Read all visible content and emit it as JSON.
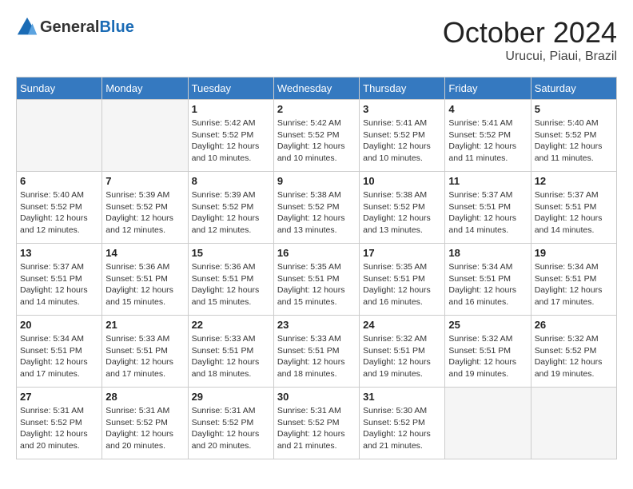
{
  "header": {
    "logo_general": "General",
    "logo_blue": "Blue",
    "month": "October 2024",
    "location": "Urucui, Piaui, Brazil"
  },
  "days_of_week": [
    "Sunday",
    "Monday",
    "Tuesday",
    "Wednesday",
    "Thursday",
    "Friday",
    "Saturday"
  ],
  "weeks": [
    [
      {
        "day": "",
        "info": ""
      },
      {
        "day": "",
        "info": ""
      },
      {
        "day": "1",
        "info": "Sunrise: 5:42 AM\nSunset: 5:52 PM\nDaylight: 12 hours and 10 minutes."
      },
      {
        "day": "2",
        "info": "Sunrise: 5:42 AM\nSunset: 5:52 PM\nDaylight: 12 hours and 10 minutes."
      },
      {
        "day": "3",
        "info": "Sunrise: 5:41 AM\nSunset: 5:52 PM\nDaylight: 12 hours and 10 minutes."
      },
      {
        "day": "4",
        "info": "Sunrise: 5:41 AM\nSunset: 5:52 PM\nDaylight: 12 hours and 11 minutes."
      },
      {
        "day": "5",
        "info": "Sunrise: 5:40 AM\nSunset: 5:52 PM\nDaylight: 12 hours and 11 minutes."
      }
    ],
    [
      {
        "day": "6",
        "info": "Sunrise: 5:40 AM\nSunset: 5:52 PM\nDaylight: 12 hours and 12 minutes."
      },
      {
        "day": "7",
        "info": "Sunrise: 5:39 AM\nSunset: 5:52 PM\nDaylight: 12 hours and 12 minutes."
      },
      {
        "day": "8",
        "info": "Sunrise: 5:39 AM\nSunset: 5:52 PM\nDaylight: 12 hours and 12 minutes."
      },
      {
        "day": "9",
        "info": "Sunrise: 5:38 AM\nSunset: 5:52 PM\nDaylight: 12 hours and 13 minutes."
      },
      {
        "day": "10",
        "info": "Sunrise: 5:38 AM\nSunset: 5:52 PM\nDaylight: 12 hours and 13 minutes."
      },
      {
        "day": "11",
        "info": "Sunrise: 5:37 AM\nSunset: 5:51 PM\nDaylight: 12 hours and 14 minutes."
      },
      {
        "day": "12",
        "info": "Sunrise: 5:37 AM\nSunset: 5:51 PM\nDaylight: 12 hours and 14 minutes."
      }
    ],
    [
      {
        "day": "13",
        "info": "Sunrise: 5:37 AM\nSunset: 5:51 PM\nDaylight: 12 hours and 14 minutes."
      },
      {
        "day": "14",
        "info": "Sunrise: 5:36 AM\nSunset: 5:51 PM\nDaylight: 12 hours and 15 minutes."
      },
      {
        "day": "15",
        "info": "Sunrise: 5:36 AM\nSunset: 5:51 PM\nDaylight: 12 hours and 15 minutes."
      },
      {
        "day": "16",
        "info": "Sunrise: 5:35 AM\nSunset: 5:51 PM\nDaylight: 12 hours and 15 minutes."
      },
      {
        "day": "17",
        "info": "Sunrise: 5:35 AM\nSunset: 5:51 PM\nDaylight: 12 hours and 16 minutes."
      },
      {
        "day": "18",
        "info": "Sunrise: 5:34 AM\nSunset: 5:51 PM\nDaylight: 12 hours and 16 minutes."
      },
      {
        "day": "19",
        "info": "Sunrise: 5:34 AM\nSunset: 5:51 PM\nDaylight: 12 hours and 17 minutes."
      }
    ],
    [
      {
        "day": "20",
        "info": "Sunrise: 5:34 AM\nSunset: 5:51 PM\nDaylight: 12 hours and 17 minutes."
      },
      {
        "day": "21",
        "info": "Sunrise: 5:33 AM\nSunset: 5:51 PM\nDaylight: 12 hours and 17 minutes."
      },
      {
        "day": "22",
        "info": "Sunrise: 5:33 AM\nSunset: 5:51 PM\nDaylight: 12 hours and 18 minutes."
      },
      {
        "day": "23",
        "info": "Sunrise: 5:33 AM\nSunset: 5:51 PM\nDaylight: 12 hours and 18 minutes."
      },
      {
        "day": "24",
        "info": "Sunrise: 5:32 AM\nSunset: 5:51 PM\nDaylight: 12 hours and 19 minutes."
      },
      {
        "day": "25",
        "info": "Sunrise: 5:32 AM\nSunset: 5:51 PM\nDaylight: 12 hours and 19 minutes."
      },
      {
        "day": "26",
        "info": "Sunrise: 5:32 AM\nSunset: 5:52 PM\nDaylight: 12 hours and 19 minutes."
      }
    ],
    [
      {
        "day": "27",
        "info": "Sunrise: 5:31 AM\nSunset: 5:52 PM\nDaylight: 12 hours and 20 minutes."
      },
      {
        "day": "28",
        "info": "Sunrise: 5:31 AM\nSunset: 5:52 PM\nDaylight: 12 hours and 20 minutes."
      },
      {
        "day": "29",
        "info": "Sunrise: 5:31 AM\nSunset: 5:52 PM\nDaylight: 12 hours and 20 minutes."
      },
      {
        "day": "30",
        "info": "Sunrise: 5:31 AM\nSunset: 5:52 PM\nDaylight: 12 hours and 21 minutes."
      },
      {
        "day": "31",
        "info": "Sunrise: 5:30 AM\nSunset: 5:52 PM\nDaylight: 12 hours and 21 minutes."
      },
      {
        "day": "",
        "info": ""
      },
      {
        "day": "",
        "info": ""
      }
    ]
  ]
}
